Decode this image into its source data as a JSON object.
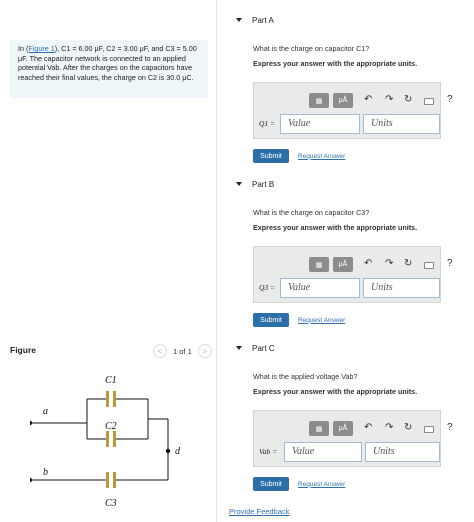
{
  "problem": {
    "text_1": "In (",
    "link": "Figure 1",
    "text_2": "), C1 = 6.00 μF, C2 = 3.00 μF, and C3 = 5.00 μF. The capacitor network is connected to an applied potential Vab. After the charges on the capacitors have reached their final values, the charge on C2 is 30.0 μC."
  },
  "figure": {
    "title": "Figure",
    "pager": "1 of 1",
    "prev": "<",
    "next": ">",
    "labels": {
      "a": "a",
      "b": "b",
      "d": "d",
      "c1": "C1",
      "c2": "C2",
      "c3": "C3"
    }
  },
  "parts": [
    {
      "title": "Part A",
      "question": "What is the charge on capacitor C1?",
      "instruction": "Express your answer with the appropriate units.",
      "answer_label": "Q1 =",
      "value_placeholder": "Value",
      "units_placeholder": "Units",
      "submit": "Submit",
      "request": "Request Answer"
    },
    {
      "title": "Part B",
      "question": "What is the charge on capacitor C3?",
      "instruction": "Express your answer with the appropriate units.",
      "answer_label": "Q3 =",
      "value_placeholder": "Value",
      "units_placeholder": "Units",
      "submit": "Submit",
      "request": "Request Answer"
    },
    {
      "title": "Part C",
      "question": "What is the applied voltage Vab?",
      "instruction": "Express your answer with the appropriate units.",
      "answer_label": "Vab =",
      "value_placeholder": "Value",
      "units_placeholder": "Units",
      "submit": "Submit",
      "request": "Request Answer"
    }
  ],
  "toolbar": {
    "template_icon": "template-icon",
    "units_icon": "units-icon",
    "units_glyph": "μÅ",
    "undo_icon": "undo-icon",
    "redo_icon": "redo-icon",
    "reset_icon": "reset-icon",
    "keyboard_icon": "keyboard-icon",
    "help_glyph": "?"
  },
  "footer": {
    "feedback": "Provide Feedback"
  },
  "colors": {
    "accent": "#2c6ea8",
    "link": "#2f6fb0",
    "panel": "#e9eaea",
    "info_bg": "#eef6f9",
    "capacitor": "#b89a3a"
  }
}
